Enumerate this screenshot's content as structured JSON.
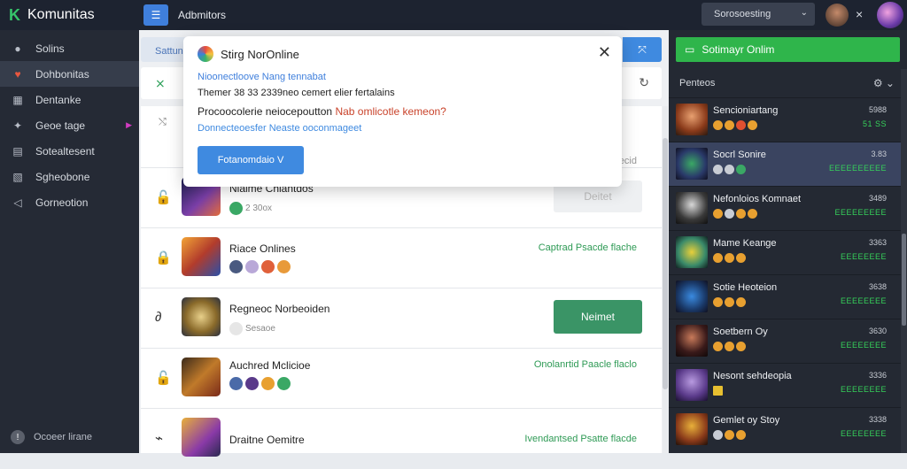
{
  "topbar": {
    "brand": "Komunitas",
    "menu_icon": "list-icon",
    "title": "Adbmitors",
    "search_label": "Sorosoesting",
    "search_chev": "⌄",
    "close_glyph": "×"
  },
  "sidebar": {
    "items": [
      {
        "label": "Solins",
        "icon": "users-icon",
        "glyph": "●"
      },
      {
        "label": "Dohbonitas",
        "icon": "shield-icon",
        "glyph": "♥"
      },
      {
        "label": "Dentanke",
        "icon": "grid-icon",
        "glyph": "▦"
      },
      {
        "label": "Geoe tage",
        "icon": "gamepad-icon",
        "glyph": "✦"
      },
      {
        "label": "Sotealtesent",
        "icon": "document-icon",
        "glyph": "▤"
      },
      {
        "label": "Sgheobone",
        "icon": "list-icon",
        "glyph": "▧"
      },
      {
        "label": "Gorneotion",
        "icon": "share-icon",
        "glyph": "◁"
      }
    ],
    "footer": "Ocoeer lirane"
  },
  "main": {
    "header": "Sattun",
    "header_btn": "⤧",
    "top_row_icon": "⤭",
    "top_row_right": "lecid"
  },
  "popup": {
    "title": "Stirg NorOnline",
    "l1": "Nioonectloove Nang tennabat",
    "l2": "Themer 38 33 2339neo cemert elier fertalains",
    "l3_a": "Procoocolerie neiocepoutton",
    "l3_b": "Nab omlicotle kemeon?",
    "l4": "Donnecteoesfer Neaste ooconmageet",
    "button": "Fotanomdaio V"
  },
  "rows": [
    {
      "name": "Niaime Chlantdos",
      "meta_text": "2 30ox",
      "button": "Deitet",
      "button_style": "disabled",
      "status": "",
      "lock": "🔓"
    },
    {
      "name": "Riace Onlines",
      "meta_text": "",
      "button": "",
      "button_style": "",
      "status": "Captrad Psacde flache",
      "lock": "🔒"
    },
    {
      "name": "Regneoc Norbeoiden",
      "meta_text": "Sesaoe",
      "button": "Neimet",
      "button_style": "green",
      "status": "",
      "lock": "∂"
    },
    {
      "name": "Auchred Mclicioe",
      "meta_text": "",
      "button": "",
      "button_style": "",
      "status": "Onolanrtid Paacle flaclo",
      "lock": "🔓"
    },
    {
      "name": "Draitne Oemitre",
      "meta_text": "",
      "button": "",
      "button_style": "",
      "status": "Ivendantsed Psatte flacde",
      "lock": "⌁"
    }
  ],
  "right": {
    "header": "Sotimayr Onlim",
    "section": "Penteos",
    "friends": [
      {
        "name": "Sencioniartang",
        "time": "5988",
        "stat": "51 SS"
      },
      {
        "name": "Socrl Sonire",
        "time": "3.83",
        "stat": "EEEEEEEEEE"
      },
      {
        "name": "Nefonloios Komnaet",
        "time": "3489",
        "stat": "EEEEEEEEE"
      },
      {
        "name": "Mame Keange",
        "time": "3363",
        "stat": "EEEEEEEE"
      },
      {
        "name": "Sotie Heoteion",
        "time": "3638",
        "stat": "EEEEEEEE"
      },
      {
        "name": "Soetbern Oy",
        "time": "3630",
        "stat": "EEEEEEEE"
      },
      {
        "name": "Nesont sehdeopia",
        "time": "3336",
        "stat": "EEEEEEEE"
      },
      {
        "name": "Gemlet oy Stoy",
        "time": "3338",
        "stat": "EEEEEEEE"
      }
    ]
  }
}
